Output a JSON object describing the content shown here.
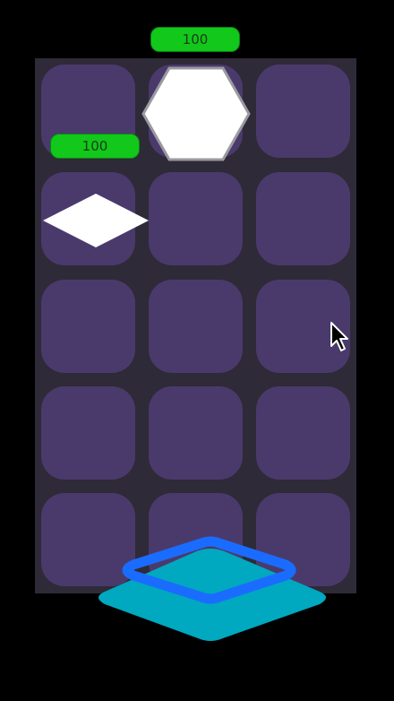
{
  "board": {
    "rows": 5,
    "cols": 3,
    "cells": [
      {
        "row": 1,
        "col": 1
      },
      {
        "row": 1,
        "col": 2
      },
      {
        "row": 1,
        "col": 3
      },
      {
        "row": 2,
        "col": 1
      },
      {
        "row": 2,
        "col": 2
      },
      {
        "row": 2,
        "col": 3
      },
      {
        "row": 3,
        "col": 1
      },
      {
        "row": 3,
        "col": 2
      },
      {
        "row": 3,
        "col": 3
      },
      {
        "row": 4,
        "col": 1
      },
      {
        "row": 4,
        "col": 2
      },
      {
        "row": 4,
        "col": 3
      },
      {
        "row": 5,
        "col": 1
      },
      {
        "row": 5,
        "col": 2
      },
      {
        "row": 5,
        "col": 3
      }
    ]
  },
  "enemies": [
    {
      "shape": "hexagon",
      "row": 1,
      "col": 2,
      "hp_label": "100",
      "hp": 100
    },
    {
      "shape": "diamond",
      "row": 2,
      "col": 1,
      "hp_label": "100",
      "hp": 100
    }
  ],
  "player_base": {
    "shape": "diamond-platform",
    "icon": "player-base-icon"
  },
  "colors": {
    "background": "#000000",
    "board": "#2e2a38",
    "cell": "#4a3a6c",
    "hp_bar": "#12c81a",
    "enemy": "#ffffff",
    "base_outline": "#1a6cff",
    "base_fill": "#00a8c0"
  }
}
